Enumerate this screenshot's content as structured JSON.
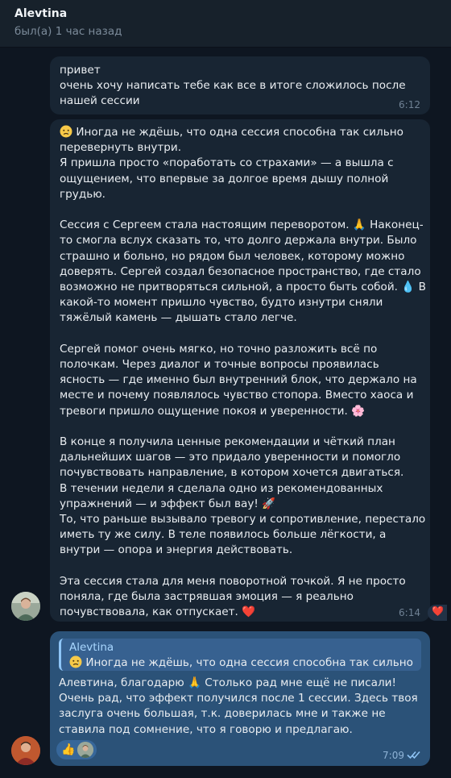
{
  "header": {
    "contact_name": "Alevtina",
    "status": "был(а) 1 час назад"
  },
  "messages": [
    {
      "text": "привет\nочень хочу написать тебе как все в итоге сложилось после нашей сессии",
      "time": "6:12"
    },
    {
      "paragraphs": [
        {
          "em": "sad-face-emoji",
          "text": " Иногда не ждёшь, что одна сессия способна так сильно перевернуть внутри.\nЯ пришла просто «поработать со страхами» — а вышла с ощущением, что впервые за долгое время дышу полной грудью."
        },
        {
          "text": "Сессия с Сергеем стала настоящим переворотом. 🙏 Наконец-то смогла вслух сказать то, что долго держала внутри. Было страшно и больно, но рядом был человек, которому можно доверять. Сергей создал безопасное пространство, где стало возможно не притворяться сильной, а просто быть собой. 💧 В какой-то момент пришло чувство, будто изнутри сняли тяжёлый камень — дышать стало легче."
        },
        {
          "text": "Сергей помог очень мягко, но точно разложить всё по полочкам. Через диалог и точные вопросы проявилась ясность — где именно был внутренний блок, что держало на месте и почему появлялось чувство стопора. Вместо хаоса и тревоги пришло ощущение покоя и уверенности. 🌸"
        },
        {
          "text": "В конце я получила ценные рекомендации и чёткий план дальнейших шагов — это придало уверенности и помогло почувствовать направление, в котором хочется двигаться.\nВ течении недели я сделала одно из рекомендованных упражнений — и эффект был вау! 🚀\nТо, что раньше вызывало тревогу и сопротивление, перестало иметь ту же силу. В теле появилось больше лёгкости, а внутри — опора и энергия действовать."
        },
        {
          "text": "Эта сессия стала для меня поворотной точкой. Я не просто поняла, где была застрявшая эмоция — я реально почувствовала, как отпускает. ❤️"
        }
      ],
      "time": "6:14",
      "reaction": "❤️"
    },
    {
      "reply_to_name": "Alevtina",
      "reply_snippet": " Иногда не ждёшь, что одна сессия способна так сильно ...",
      "text": "Алевтина, благодарю 🙏 Столько рад мне ещё не писали!\nОчень рад, что эффект получился после 1 сессии. Здесь твоя заслуга очень большая, т.к. доверилась мне и также не ставила под сомнение, что я говорю и предлагаю.",
      "time": "7:09",
      "reaction": "👍",
      "status_icon": "double-check-icon"
    }
  ],
  "colors": {
    "background": "#0e1621",
    "header": "#17212b",
    "incoming_bubble": "#182533",
    "outgoing_bubble": "#2b5278",
    "accent": "#6ab3f3"
  }
}
